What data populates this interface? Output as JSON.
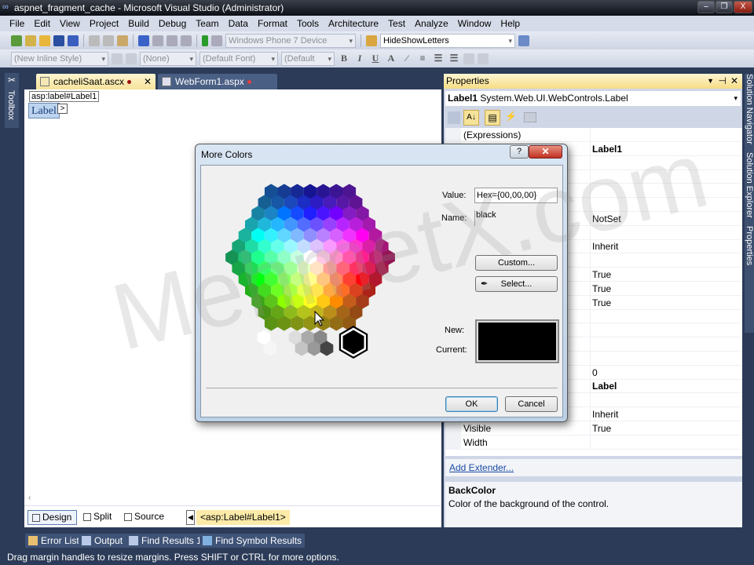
{
  "window": {
    "title": "aspnet_fragment_cache - Microsoft Visual Studio (Administrator)"
  },
  "menu": [
    "File",
    "Edit",
    "View",
    "Project",
    "Build",
    "Debug",
    "Team",
    "Data",
    "Format",
    "Tools",
    "Architecture",
    "Test",
    "Analyze",
    "Window",
    "Help"
  ],
  "toolbar1": {
    "device": "Windows Phone 7 Device",
    "project": "HideShowLetters"
  },
  "toolbar2": {
    "style": "(New Inline Style)",
    "block": "(None)",
    "font": "(Default Font)",
    "size": "(Default"
  },
  "toolbox": "Toolbox",
  "tabs": [
    {
      "label": "cacheliSaat.ascx",
      "active": true
    },
    {
      "label": "WebForm1.aspx",
      "active": false
    }
  ],
  "editor": {
    "tag": "asp:label#Label1",
    "label": "Label",
    "smart_tag": ">"
  },
  "views": {
    "design": "Design",
    "split": "Split",
    "source": "Source",
    "breadcrumb": "<asp:Label#Label1>"
  },
  "output_tabs": [
    "Error List",
    "Output",
    "Find Results 1",
    "Find Symbol Results"
  ],
  "status": "Drag margin handles to resize margins. Press SHIFT or CTRL for more options.",
  "properties": {
    "title": "Properties",
    "object": "Label1",
    "object_type": "System.Web.UI.WebControls.Label",
    "rows": [
      {
        "name": "(Expressions)",
        "value": ""
      },
      {
        "name": "",
        "value": "Label1",
        "bold": true
      },
      {
        "name": "",
        "value": ""
      },
      {
        "name": "",
        "value": ""
      },
      {
        "name": "",
        "value": ""
      },
      {
        "name": "",
        "value": ""
      },
      {
        "name": "",
        "value": "NotSet"
      },
      {
        "name": "",
        "value": ""
      },
      {
        "name": "",
        "value": "Inherit"
      },
      {
        "name": "",
        "value": ""
      },
      {
        "name": "",
        "value": "True"
      },
      {
        "name": "",
        "value": "True"
      },
      {
        "name": "",
        "value": "True"
      },
      {
        "name": "",
        "value": ""
      },
      {
        "name": "",
        "value": ""
      },
      {
        "name": "",
        "value": ""
      },
      {
        "name": "",
        "value": ""
      },
      {
        "name": "",
        "value": "0"
      },
      {
        "name": "",
        "value": "Label",
        "bold": true
      },
      {
        "name": "",
        "value": ""
      },
      {
        "name": "",
        "value": "Inherit"
      },
      {
        "name": "Visible",
        "value": "True"
      },
      {
        "name": "Width",
        "value": ""
      }
    ],
    "add_extender": "Add Extender...",
    "desc_title": "BackColor",
    "desc_text": "Color of the background of the control."
  },
  "side_tabs": [
    "Solution Navigator",
    "Solution Explorer",
    "Properties"
  ],
  "dialog": {
    "title": "More Colors",
    "value_label": "Value:",
    "value": "Hex={00,00,00}",
    "name_label": "Name:",
    "name": "black",
    "custom": "Custom...",
    "select": "Select...",
    "new_label": "New:",
    "current_label": "Current:",
    "new_color": "#000000",
    "current_color": "#000000",
    "ok": "OK",
    "cancel": "Cancel"
  },
  "watermark": "MehmetX.com"
}
